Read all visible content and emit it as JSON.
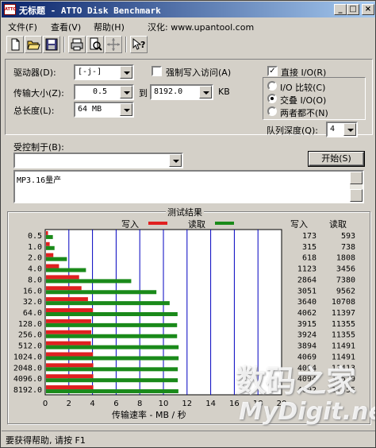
{
  "window": {
    "title": "无标题 - ATTO Disk Benchmark",
    "app_icon_text": "ATTO",
    "minimize_glyph": "_",
    "maximize_glyph": "□",
    "close_glyph": "×"
  },
  "menu": {
    "file": "文件(F)",
    "view": "查看(V)",
    "help": "帮助(H)",
    "localized_by": "汉化: www.upantool.com"
  },
  "toolbar": {
    "icons": [
      "new-file-icon",
      "open-folder-icon",
      "save-icon",
      "print-icon",
      "print-preview-icon",
      "move-icon",
      "context-help-icon"
    ]
  },
  "settings": {
    "drive_label": "驱动器(D):",
    "drive_value": "[-j-]",
    "force_write_label": "强制写入访问(A)",
    "force_write_checked": false,
    "transfer_size_label": "传输大小(Z):",
    "transfer_from": "0.5",
    "transfer_to_label": "到",
    "transfer_to": "8192.0",
    "transfer_unit": "KB",
    "total_length_label": "总长度(L):",
    "total_length": "64 MB",
    "direct_io_label": "直接 I/O(R)",
    "direct_io_checked": true,
    "radio_io_compare": "I/O 比较(C)",
    "radio_overlapped": "交叠 I/O(O)",
    "radio_neither": "两者都不(N)",
    "selected_radio": "overlapped",
    "queue_depth_label": "队列深度(Q):",
    "queue_depth": "4",
    "controlled_by_label": "受控制于(B):",
    "controlled_by_value": "",
    "start_button": "开始(S)",
    "description": "MP3.16量产"
  },
  "results": {
    "group_title": "测试结果",
    "legend_write": "写入",
    "legend_read": "读取",
    "col_write": "写入",
    "col_read": "读取",
    "write_color": "#e02020",
    "read_color": "#1a8a1a",
    "x_axis_label": "传输速率 - MB / 秒"
  },
  "chart_data": {
    "type": "bar",
    "orientation": "horizontal",
    "categories": [
      "0.5",
      "1.0",
      "2.0",
      "4.0",
      "8.0",
      "16.0",
      "32.0",
      "64.0",
      "128.0",
      "256.0",
      "512.0",
      "1024.0",
      "2048.0",
      "4096.0",
      "8192.0"
    ],
    "series": [
      {
        "name": "写入",
        "values": [
          0.17,
          0.31,
          0.62,
          1.1,
          2.8,
          3.0,
          3.55,
          3.97,
          3.82,
          3.83,
          3.8,
          3.97,
          4.0,
          4.0,
          4.0
        ]
      },
      {
        "name": "读取",
        "values": [
          0.58,
          0.72,
          1.77,
          3.38,
          7.21,
          9.34,
          10.46,
          11.13,
          11.09,
          11.09,
          11.22,
          11.22,
          11.15,
          11.15,
          11.2
        ]
      }
    ],
    "write_kbps": [
      "173",
      "315",
      "618",
      "1123",
      "2864",
      "3051",
      "3640",
      "4062",
      "3915",
      "3924",
      "3894",
      "4069",
      "4094",
      "4094",
      "4092"
    ],
    "read_kbps": [
      "593",
      "738",
      "1808",
      "3456",
      "7380",
      "9562",
      "10708",
      "11397",
      "11355",
      "11355",
      "11491",
      "11491",
      "11413",
      "11519",
      "11555"
    ],
    "x_ticks": [
      "0",
      "2",
      "4",
      "6",
      "8",
      "10",
      "12",
      "14",
      "16",
      "18",
      "20"
    ],
    "xlim": [
      0,
      20
    ],
    "xlabel": "传输速率 - MB / 秒",
    "grid": true
  },
  "status": {
    "text": "要获得帮助, 请按 F1"
  },
  "watermark": {
    "line1": "数码之家",
    "line2": "MyDigit.net"
  }
}
